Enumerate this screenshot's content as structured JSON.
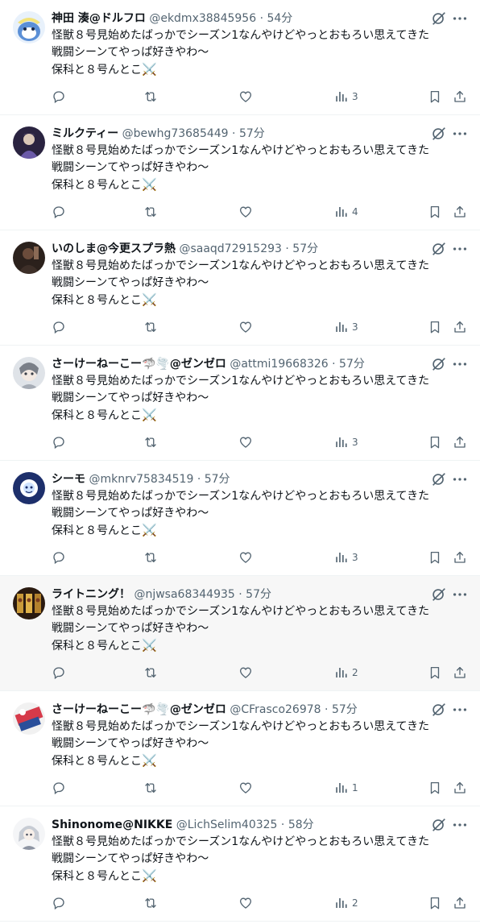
{
  "colors": {
    "text": "#0f1419",
    "muted": "#536471",
    "divider": "#eff3f4",
    "hover_bg": "#f7f7f7"
  },
  "icons": {
    "reply": "reply-icon",
    "retweet": "retweet-icon",
    "like": "heart-icon",
    "views": "views-chart-icon",
    "bookmark": "bookmark-icon",
    "share": "share-icon",
    "grok": "grok-icon",
    "more": "more-icon"
  },
  "posts": [
    {
      "name": "神田 湊@ドルフロ",
      "handle": "@ekdmx38845956",
      "dot": "·",
      "time": "54分",
      "line1": "怪獣８号見始めたばっかでシーズン1なんやけどやっとおもろい思えてきた",
      "line2": "戦闘シーンてやっぱ好きやわ〜",
      "line3": "保科と８号んとこ",
      "emoji": "⚔️",
      "views": "3",
      "avatar_theme": "blue-character"
    },
    {
      "name": "ミルクティー",
      "handle": "@bewhg73685449",
      "dot": "·",
      "time": "57分",
      "line1": "怪獣８号見始めたばっかでシーズン1なんやけどやっとおもろい思えてきた",
      "line2": "戦闘シーンてやっぱ好きやわ〜",
      "line3": "保科と８号んとこ",
      "emoji": "⚔️",
      "views": "4",
      "avatar_theme": "dark-purple"
    },
    {
      "name": "いのしま@今更スプラ熱",
      "handle": "@saaqd72915293",
      "dot": "·",
      "time": "57分",
      "line1": "怪獣８号見始めたばっかでシーズン1なんやけどやっとおもろい思えてきた",
      "line2": "戦闘シーンてやっぱ好きやわ〜",
      "line3": "保科と８号んとこ",
      "emoji": "⚔️",
      "views": "3",
      "avatar_theme": "dark-brown"
    },
    {
      "name": "さーけーねーこー🦈🌪️@ゼンゼロ",
      "handle": "@attmi19668326",
      "dot": "·",
      "time": "57分",
      "line1": "怪獣８号見始めたばっかでシーズン1なんやけどやっとおもろい思えてきた",
      "line2": "戦闘シーンてやっぱ好きやわ〜",
      "line3": "保科と８号んとこ",
      "emoji": "⚔️",
      "views": "3",
      "avatar_theme": "grey-character"
    },
    {
      "name": "シーモ",
      "handle": "@mknrv75834519",
      "dot": "·",
      "time": "57分",
      "line1": "怪獣８号見始めたばっかでシーズン1なんやけどやっとおもろい思えてきた",
      "line2": "戦闘シーンてやっぱ好きやわ〜",
      "line3": "保科と８号んとこ",
      "emoji": "⚔️",
      "views": "3",
      "avatar_theme": "navy-white"
    },
    {
      "name": "ライトニング！",
      "handle": "@njwsa68344935",
      "dot": "·",
      "time": "57分",
      "line1": "怪獣８号見始めたばっかでシーズン1なんやけどやっとおもろい思えてきた",
      "line2": "戦闘シーンてやっぱ好きやわ〜",
      "line3": "保科と８号んとこ",
      "emoji": "⚔️",
      "views": "2",
      "avatar_theme": "gold-cards"
    },
    {
      "name": "さーけーねーこー🦈🌪️@ゼンゼロ",
      "handle": "@CFrasco26978",
      "dot": "·",
      "time": "57分",
      "line1": "怪獣８号見始めたばっかでシーズン1なんやけどやっとおもろい思えてきた",
      "line2": "戦闘シーンてやっぱ好きやわ〜",
      "line3": "保科と８号んとこ",
      "emoji": "⚔️",
      "views": "1",
      "avatar_theme": "red-blue"
    },
    {
      "name": "Shinonome@NIKKE",
      "handle": "@LichSelim40325",
      "dot": "·",
      "time": "58分",
      "line1": "怪獣８号見始めたばっかでシーズン1なんやけどやっとおもろい思えてきた",
      "line2": "戦闘シーンてやっぱ好きやわ〜",
      "line3": "保科と８号んとこ",
      "emoji": "⚔️",
      "views": "2",
      "avatar_theme": "silver-character"
    }
  ]
}
